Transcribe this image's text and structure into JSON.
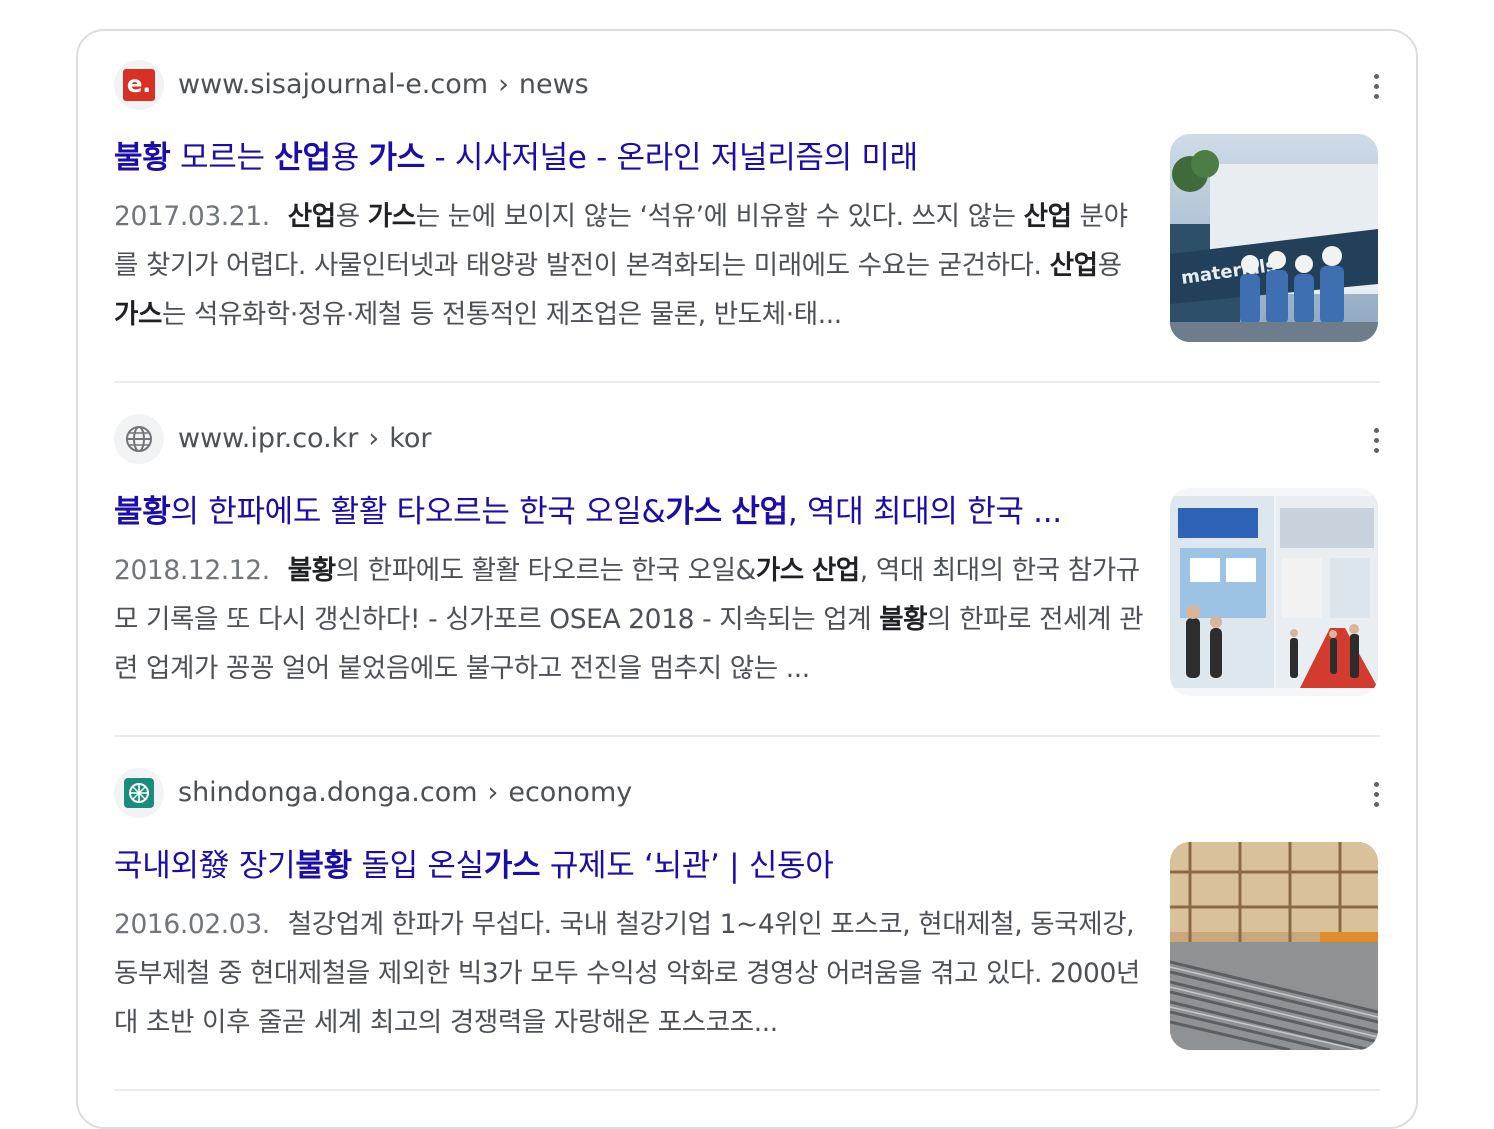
{
  "results": [
    {
      "favicon": "sisajournal-e-logo-icon",
      "favicon_text": "e.",
      "domain": "www.sisajournal-e.com",
      "path": "news",
      "title_parts": [
        {
          "t": "불황",
          "b": true
        },
        {
          "t": " 모르는 ",
          "b": false
        },
        {
          "t": "산업",
          "b": true
        },
        {
          "t": "용 ",
          "b": false
        },
        {
          "t": "가스",
          "b": true
        },
        {
          "t": " - 시사저널e - 온라인 저널리즘의 미래",
          "b": false
        }
      ],
      "date": "2017.03.21.",
      "snippet_parts": [
        {
          "t": "산업",
          "b": true
        },
        {
          "t": "용 ",
          "b": false
        },
        {
          "t": "가스",
          "b": true
        },
        {
          "t": "는 눈에 보이지 않는 ‘석유’에 비유할 수 있다. 쓰지 않는 ",
          "b": false
        },
        {
          "t": "산업",
          "b": true
        },
        {
          "t": " 분야를 찾기가 어렵다. 사물인터넷과 태양광 발전이 본격화되는 미래에도 수요는 굳건하다. ",
          "b": false
        },
        {
          "t": "산업",
          "b": true
        },
        {
          "t": "용 ",
          "b": false
        },
        {
          "t": "가스",
          "b": true
        },
        {
          "t": "는 석유화학·정유·제철 등 전통적인 제조업은 물론, 반도체·태...",
          "b": false
        }
      ],
      "thumbnail": "industrial-gas-workers-image"
    },
    {
      "favicon": "globe-icon",
      "favicon_text": "",
      "domain": "www.ipr.co.kr",
      "path": "kor",
      "title_parts": [
        {
          "t": "불황",
          "b": true
        },
        {
          "t": "의 한파에도 활활 타오르는 한국 오일&",
          "b": false
        },
        {
          "t": "가스",
          "b": true
        },
        {
          "t": " ",
          "b": false
        },
        {
          "t": "산업",
          "b": true
        },
        {
          "t": ", 역대 최대의 한국 ...",
          "b": false
        }
      ],
      "date": "2018.12.12.",
      "snippet_parts": [
        {
          "t": "불황",
          "b": true
        },
        {
          "t": "의 한파에도 활활 타오르는 한국 오일&",
          "b": false
        },
        {
          "t": "가스",
          "b": true
        },
        {
          "t": " ",
          "b": false
        },
        {
          "t": "산업",
          "b": true
        },
        {
          "t": ", 역대 최대의 한국 참가규모 기록을 또 다시 갱신하다! - 싱가포르 OSEA 2018 - 지속되는 업계 ",
          "b": false
        },
        {
          "t": "불황",
          "b": true
        },
        {
          "t": "의 한파로 전세계 관련 업계가 꽁꽁 얼어 붙었음에도 불구하고 전진을 멈추지 않는 ...",
          "b": false
        }
      ],
      "thumbnail": "exhibition-hall-image"
    },
    {
      "favicon": "shindonga-logo-icon",
      "favicon_text": "",
      "domain": "shindonga.donga.com",
      "path": "economy",
      "title_parts": [
        {
          "t": "국내외發 장기",
          "b": false
        },
        {
          "t": "불황",
          "b": true
        },
        {
          "t": " 돌입 온실",
          "b": false
        },
        {
          "t": "가스",
          "b": true
        },
        {
          "t": " 규제도 ‘뇌관’ | 신동아",
          "b": false
        }
      ],
      "date": "2016.02.03.",
      "snippet_parts": [
        {
          "t": "철강업계 한파가 무섭다. 국내 철강기업 1~4위인 포스코, 현대제철, 동국제강, 동부제철 중 현대제철을 제외한 빅3가 모두 수익성 악화로 경영상 어려움을 겪고 있다. 2000년대 초반 이후 줄곧 세계 최고의 경쟁력을 자랑해온 포스코조...",
          "b": false
        }
      ],
      "thumbnail": "steel-rebar-construction-image"
    }
  ],
  "breadcrumb_separator": "›",
  "colors": {
    "link": "#1a0dab",
    "text": "#4d5156",
    "date": "#70757a",
    "bold": "#202124"
  }
}
